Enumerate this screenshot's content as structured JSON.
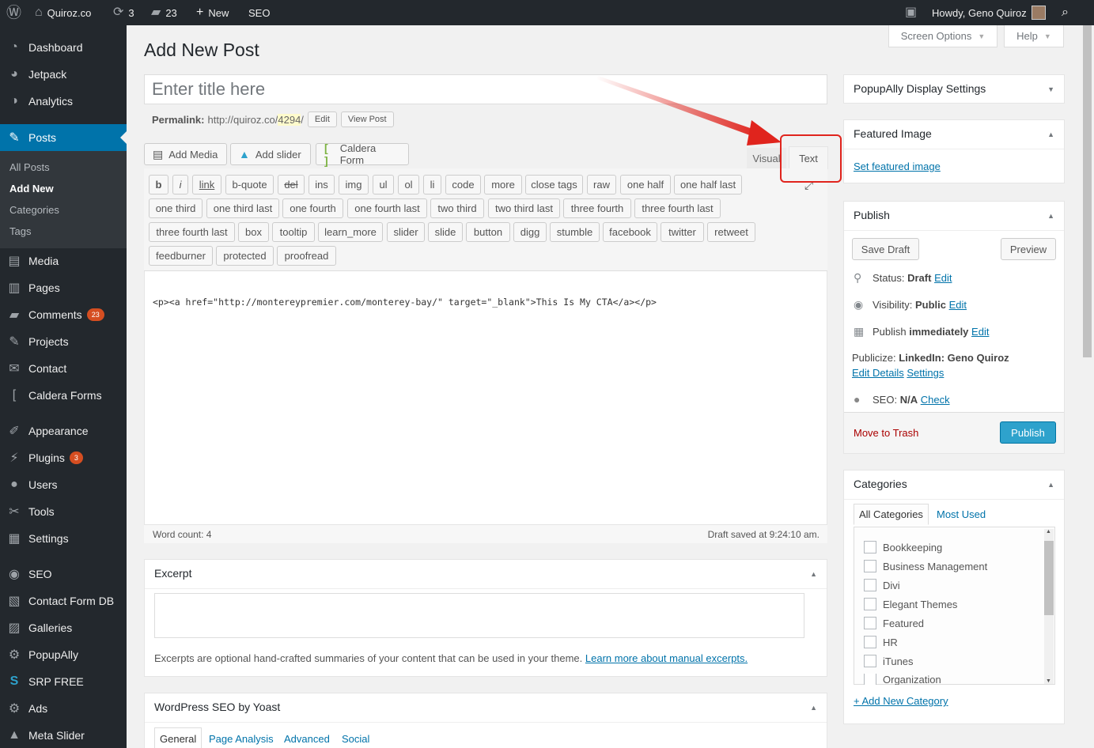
{
  "adminbar": {
    "site_name": "Quiroz.co",
    "updates_count": "3",
    "comments_count": "23",
    "new_label": "New",
    "seo_label": "SEO",
    "howdy": "Howdy, Geno Quiroz"
  },
  "sidebar": {
    "items": [
      {
        "label": "Dashboard",
        "icon": "dashboard-icon"
      },
      {
        "label": "Jetpack",
        "icon": "jetpack-icon"
      },
      {
        "label": "Analytics",
        "icon": "analytics-icon"
      },
      {
        "label": "Posts",
        "icon": "pin-icon"
      },
      {
        "label": "Media",
        "icon": "media-icon"
      },
      {
        "label": "Pages",
        "icon": "pages-icon"
      },
      {
        "label": "Comments",
        "icon": "comments-icon",
        "badge": "23"
      },
      {
        "label": "Projects",
        "icon": "pin-icon"
      },
      {
        "label": "Contact",
        "icon": "mail-icon"
      },
      {
        "label": "Caldera Forms",
        "icon": "caldera-icon"
      },
      {
        "label": "Appearance",
        "icon": "brush-icon"
      },
      {
        "label": "Plugins",
        "icon": "plugin-icon",
        "badge": "3"
      },
      {
        "label": "Users",
        "icon": "users-icon"
      },
      {
        "label": "Tools",
        "icon": "tools-icon"
      },
      {
        "label": "Settings",
        "icon": "settings-icon"
      },
      {
        "label": "SEO",
        "icon": "seo-icon"
      },
      {
        "label": "Contact Form DB",
        "icon": "db-icon"
      },
      {
        "label": "Galleries",
        "icon": "gallery-icon"
      },
      {
        "label": "PopupAlly",
        "icon": "gear-icon"
      },
      {
        "label": "SRP FREE",
        "icon": "srp-icon"
      },
      {
        "label": "Ads",
        "icon": "gear-icon"
      },
      {
        "label": "Meta Slider",
        "icon": "slider-icon"
      }
    ],
    "posts_submenu": [
      "All Posts",
      "Add New",
      "Categories",
      "Tags"
    ]
  },
  "screen_options": "Screen Options",
  "help": "Help",
  "page_title": "Add New Post",
  "title_placeholder": "Enter title here",
  "permalink": {
    "label": "Permalink:",
    "url": "http://quiroz.co/",
    "slug": "4294",
    "trail": "/",
    "edit": "Edit",
    "view": "View Post"
  },
  "media_buttons": [
    "Add Media",
    "Add slider",
    "Caldera Form"
  ],
  "editor_tabs": {
    "visual": "Visual",
    "text": "Text"
  },
  "quicktags": [
    [
      "b",
      "i",
      "link",
      "b-quote",
      "del",
      "ins",
      "img",
      "ul",
      "ol",
      "li",
      "code",
      "more",
      "close tags",
      "raw",
      "one half",
      "one half last"
    ],
    [
      "one third",
      "one third last",
      "one fourth",
      "one fourth last",
      "two third",
      "two third last",
      "three fourth",
      "three fourth last"
    ],
    [
      "three fourth last",
      "box",
      "tooltip",
      "learn_more",
      "slider",
      "slide",
      "button",
      "digg",
      "stumble",
      "facebook",
      "twitter",
      "retweet"
    ],
    [
      "feedburner",
      "protected",
      "proofread"
    ]
  ],
  "editor_content": "<p><a href=\"http://montereypremier.com/monterey-bay/\" target=\"_blank\">This Is My CTA</a></p>",
  "word_count": "Word count: 4",
  "draft_saved": "Draft saved at 9:24:10 am.",
  "excerpt": {
    "title": "Excerpt",
    "help": "Excerpts are optional hand-crafted summaries of your content that can be used in your theme.",
    "learn_more": "Learn more about manual excerpts."
  },
  "yoast": {
    "title": "WordPress SEO by Yoast",
    "tabs": [
      "General",
      "Page Analysis",
      "Advanced",
      "Social"
    ]
  },
  "popupally": {
    "title": "PopupAlly Display Settings"
  },
  "featured_image": {
    "title": "Featured Image",
    "link": "Set featured image"
  },
  "publish": {
    "title": "Publish",
    "save_draft": "Save Draft",
    "preview": "Preview",
    "status_label": "Status:",
    "status_value": "Draft",
    "visibility_label": "Visibility:",
    "visibility_value": "Public",
    "publish_label": "Publish",
    "publish_value": "immediately",
    "edit": "Edit",
    "publicize_label": "Publicize:",
    "publicize_value": "LinkedIn: Geno Quiroz",
    "edit_details": "Edit Details",
    "settings": "Settings",
    "seo_label": "SEO:",
    "seo_value": "N/A",
    "check": "Check",
    "trash": "Move to Trash",
    "publish_button": "Publish"
  },
  "categories": {
    "title": "Categories",
    "tab_all": "All Categories",
    "tab_used": "Most Used",
    "items": [
      "Bookkeeping",
      "Business Management",
      "Divi",
      "Elegant Themes",
      "Featured",
      "HR",
      "iTunes",
      "Organization"
    ],
    "add_new": "+ Add New Category"
  },
  "colors": {
    "accent": "#0073aa",
    "adminbar": "#23282d",
    "publish_button": "#2ea2cc",
    "highlight": "#e0241d",
    "badge": "#d54e21"
  }
}
